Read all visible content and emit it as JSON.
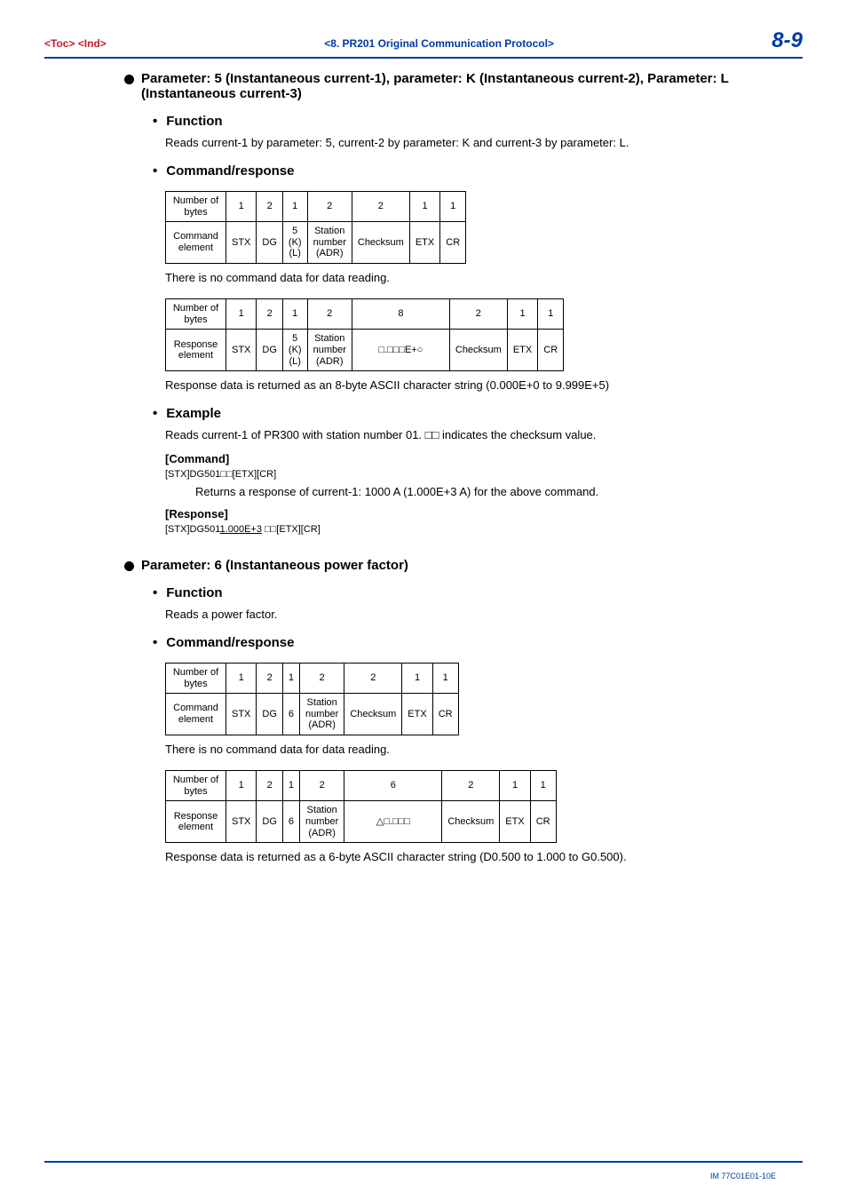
{
  "header": {
    "left": "<Toc> <Ind>",
    "center": "<8.  PR201 Original Communication Protocol>",
    "right": "8-9"
  },
  "section1": {
    "title": "Parameter: 5 (Instantaneous current-1), parameter: K (Instantaneous current-2), Parameter: L (Instantaneous current-3)",
    "func_label": "Function",
    "func_text": "Reads current-1 by parameter: 5, current-2 by parameter: K and current-3 by parameter: L.",
    "cmd_label": "Command/response",
    "cmd_table": {
      "row1_label": "Number of bytes",
      "row1": [
        "1",
        "2",
        "1",
        "2",
        "2",
        "1",
        "1"
      ],
      "row2_label": "Command element",
      "row2": [
        "STX",
        "DG",
        "5\n(K)\n(L)",
        "Station\nnumber\n(ADR)",
        "Checksum",
        "ETX",
        "CR"
      ]
    },
    "cmd_note": "There is no command data for data reading.",
    "resp_table": {
      "row1_label": "Number of bytes",
      "row1": [
        "1",
        "2",
        "1",
        "2",
        "8",
        "2",
        "1",
        "1"
      ],
      "row2_label": "Response element",
      "row2": [
        "STX",
        "DG",
        "5\n(K)\n(L)",
        "Station\nnumber\n(ADR)",
        "□.□□□E+○",
        "Checksum",
        "ETX",
        "CR"
      ]
    },
    "resp_note": "Response data is returned as an 8-byte ASCII character string (0.000E+0 to 9.999E+5)",
    "ex_label": "Example",
    "ex_text": "Reads current-1 of PR300 with station number 01. □□ indicates the checksum value.",
    "ex_cmd_head": "[Command]",
    "ex_cmd_code": "[STX]DG501□□[ETX][CR]",
    "ex_cmd_return": "Returns a response of current-1: 1000 A (1.000E+3 A) for the above command.",
    "ex_resp_head": "[Response]",
    "ex_resp_code_pre": "[STX]DG501",
    "ex_resp_code_u": "1.000E+3",
    "ex_resp_code_post": " □□[ETX][CR]"
  },
  "section2": {
    "title": "Parameter: 6 (Instantaneous power factor)",
    "func_label": "Function",
    "func_text": "Reads a power factor.",
    "cmd_label": "Command/response",
    "cmd_table": {
      "row1_label": "Number of bytes",
      "row1": [
        "1",
        "2",
        "1",
        "2",
        "2",
        "1",
        "1"
      ],
      "row2_label": "Command element",
      "row2": [
        "STX",
        "DG",
        "6",
        "Station\nnumber\n(ADR)",
        "Checksum",
        "ETX",
        "CR"
      ]
    },
    "cmd_note": "There is no command data for data reading.",
    "resp_table": {
      "row1_label": "Number of bytes",
      "row1": [
        "1",
        "2",
        "1",
        "2",
        "6",
        "2",
        "1",
        "1"
      ],
      "row2_label": "Response element",
      "row2": [
        "STX",
        "DG",
        "6",
        "Station\nnumber\n(ADR)",
        "△□.□□□",
        "Checksum",
        "ETX",
        "CR"
      ]
    },
    "resp_note": "Response data is returned as a 6-byte ASCII character string (D0.500 to 1.000 to G0.500)."
  },
  "footer": {
    "doc_no": "IM 77C01E01-10E"
  }
}
